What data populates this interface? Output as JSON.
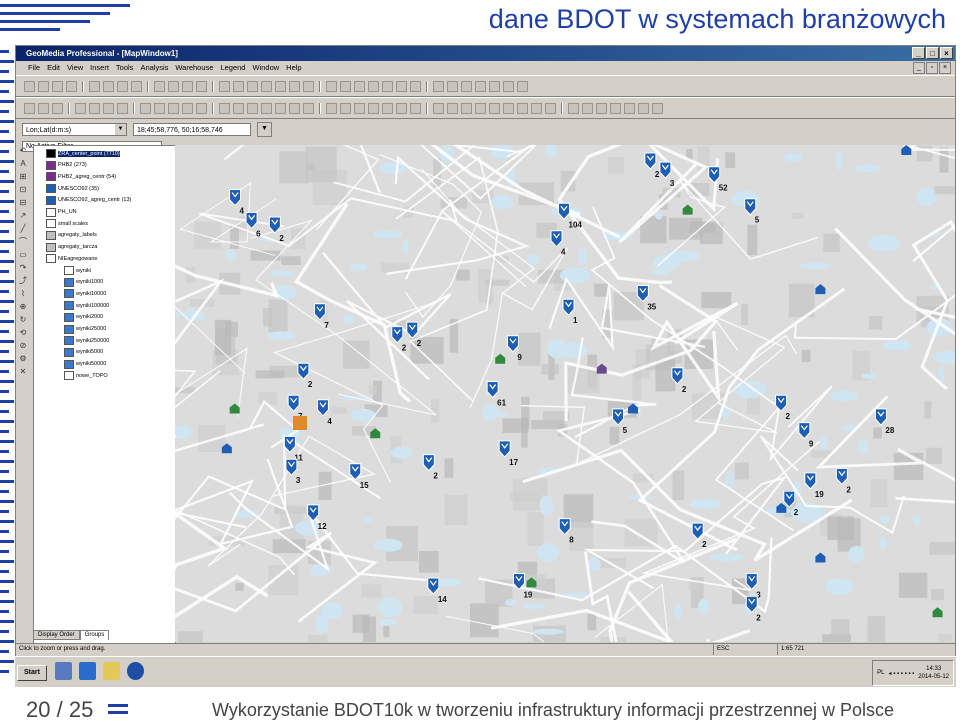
{
  "slide": {
    "title": "dane BDOT w systemach branżowych",
    "page_current": "20",
    "page_sep": "/",
    "page_total": "25",
    "footer_text": "Wykorzystanie BDOT10k w tworzeniu infrastruktury informacji przestrzennej w Polsce"
  },
  "window": {
    "title": "GeoMedia Professional - [MapWindow1]",
    "minimize": "_",
    "maximize": "□",
    "close": "×"
  },
  "menu": [
    "File",
    "Edit",
    "View",
    "Insert",
    "Tools",
    "Analysis",
    "Warehouse",
    "Legend",
    "Window",
    "Help"
  ],
  "coords": {
    "system": "Lon;Lat(d:m:s)",
    "value": "18;45;58,776, 50;16;58,746",
    "filter": "No Active Filter"
  },
  "legend": {
    "items": [
      {
        "label": "ZRA_center_point (7710)",
        "color": "#000000"
      },
      {
        "label": "PHB2 (273)",
        "color": "#7b2d8e"
      },
      {
        "label": "PHB2_agreg_centr (54)",
        "color": "#7b2d8e"
      },
      {
        "label": "UNESCO92 (35)",
        "color": "#1e5fb4"
      },
      {
        "label": "UNESCO92_agreg_centr (13)",
        "color": "#1e5fb4"
      },
      {
        "label": "PH_UN",
        "color": "#ffffff"
      },
      {
        "label": "small scales",
        "color": "#ffffff"
      },
      {
        "label": "agregaty_labels",
        "color": "#c0c0c0"
      },
      {
        "label": "agregaty_tarcza",
        "color": "#c0c0c0"
      },
      {
        "label": "NIEagregowane",
        "color": "#ffffff"
      },
      {
        "label": "wyniki",
        "color": "#ffffff"
      },
      {
        "label": "wyniki1000",
        "color": "#3a7ac8"
      },
      {
        "label": "wyniki10000",
        "color": "#3a7ac8"
      },
      {
        "label": "wyniki100000",
        "color": "#3a7ac8"
      },
      {
        "label": "wyniki2000",
        "color": "#3a7ac8"
      },
      {
        "label": "wyniki25000",
        "color": "#3a7ac8"
      },
      {
        "label": "wyniki250000",
        "color": "#3a7ac8"
      },
      {
        "label": "wyniki5000",
        "color": "#3a7ac8"
      },
      {
        "label": "wyniki50000",
        "color": "#3a7ac8"
      },
      {
        "label": "nowe_TOPO",
        "color": "#ffffff"
      }
    ],
    "tab_display": "Display Order",
    "tab_groups": "Groups"
  },
  "map": {
    "markers": [
      {
        "label": "4",
        "x": 0.062,
        "y": 0.08
      },
      {
        "label": "6",
        "x": 0.084,
        "y": 0.13
      },
      {
        "label": "2",
        "x": 0.115,
        "y": 0.14
      },
      {
        "label": "2",
        "x": 0.615,
        "y": 0.0
      },
      {
        "label": "3",
        "x": 0.635,
        "y": 0.02
      },
      {
        "label": "52",
        "x": 0.7,
        "y": 0.03
      },
      {
        "label": "5",
        "x": 0.748,
        "y": 0.1
      },
      {
        "label": "104",
        "x": 0.5,
        "y": 0.11
      },
      {
        "label": "4",
        "x": 0.49,
        "y": 0.17
      },
      {
        "label": "7",
        "x": 0.175,
        "y": 0.33
      },
      {
        "label": "2",
        "x": 0.278,
        "y": 0.38
      },
      {
        "label": "2",
        "x": 0.298,
        "y": 0.37
      },
      {
        "label": "9",
        "x": 0.432,
        "y": 0.4
      },
      {
        "label": "1",
        "x": 0.506,
        "y": 0.32
      },
      {
        "label": "35",
        "x": 0.605,
        "y": 0.29
      },
      {
        "label": "2",
        "x": 0.153,
        "y": 0.46
      },
      {
        "label": "7",
        "x": 0.14,
        "y": 0.53
      },
      {
        "label": "4",
        "x": 0.179,
        "y": 0.54
      },
      {
        "label": "61",
        "x": 0.405,
        "y": 0.5
      },
      {
        "label": "2",
        "x": 0.651,
        "y": 0.47
      },
      {
        "label": "2",
        "x": 0.789,
        "y": 0.53
      },
      {
        "label": "9",
        "x": 0.82,
        "y": 0.59
      },
      {
        "label": "28",
        "x": 0.922,
        "y": 0.56
      },
      {
        "label": "5",
        "x": 0.572,
        "y": 0.56
      },
      {
        "label": "11",
        "x": 0.135,
        "y": 0.62
      },
      {
        "label": "3",
        "x": 0.137,
        "y": 0.67
      },
      {
        "label": "15",
        "x": 0.222,
        "y": 0.68
      },
      {
        "label": "2",
        "x": 0.32,
        "y": 0.66
      },
      {
        "label": "17",
        "x": 0.421,
        "y": 0.63
      },
      {
        "label": "2",
        "x": 0.87,
        "y": 0.69
      },
      {
        "label": "19",
        "x": 0.828,
        "y": 0.7
      },
      {
        "label": "2",
        "x": 0.8,
        "y": 0.74
      },
      {
        "label": "12",
        "x": 0.166,
        "y": 0.77
      },
      {
        "label": "8",
        "x": 0.501,
        "y": 0.8
      },
      {
        "label": "2",
        "x": 0.678,
        "y": 0.81
      },
      {
        "label": "19",
        "x": 0.44,
        "y": 0.92
      },
      {
        "label": "14",
        "x": 0.326,
        "y": 0.93
      },
      {
        "label": "3",
        "x": 0.75,
        "y": 0.92
      },
      {
        "label": "2",
        "x": 0.75,
        "y": 0.97
      }
    ]
  },
  "status": {
    "hint": "Click to zoom or press and drag.",
    "mode": "ESC",
    "scale": "1:65 721"
  },
  "taskbar": {
    "start": "Start",
    "lang": "PL",
    "time": "14:33",
    "date": "2014-05-12"
  }
}
